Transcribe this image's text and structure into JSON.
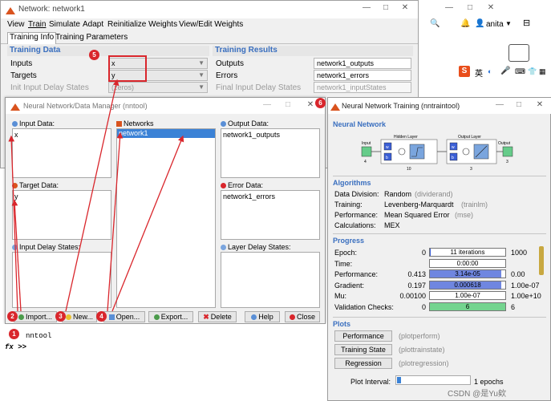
{
  "network_window": {
    "title": "Network: network1",
    "menu": [
      "View",
      "Train",
      "Simulate",
      "Adapt",
      "Reinitialize Weights",
      "View/Edit Weights"
    ],
    "tabs": [
      "Training Info",
      "Training Parameters"
    ],
    "training_data": {
      "header": "Training Data",
      "rows": [
        {
          "label": "Inputs",
          "value": "x"
        },
        {
          "label": "Targets",
          "value": "y"
        },
        {
          "label": "Init Input Delay States",
          "value": "(zeros)"
        }
      ]
    },
    "training_results": {
      "header": "Training Results",
      "rows": [
        {
          "label": "Outputs",
          "value": "network1_outputs"
        },
        {
          "label": "Errors",
          "value": "network1_errors"
        },
        {
          "label": "Final Input Delay States",
          "value": "network1_inputStates"
        }
      ]
    }
  },
  "tray": {
    "user": "anita",
    "ime": "英"
  },
  "data_manager": {
    "title": "Neural Network/Data Manager (nntool)",
    "input_data": {
      "label": "Input Data:",
      "items": [
        "x"
      ]
    },
    "networks": {
      "label": "Networks",
      "items": [
        "network1"
      ]
    },
    "output_data": {
      "label": "Output Data:",
      "items": [
        "network1_outputs"
      ]
    },
    "target_data": {
      "label": "Target Data:",
      "items": [
        "y"
      ]
    },
    "error_data": {
      "label": "Error Data:",
      "items": [
        "network1_errors"
      ]
    },
    "input_delay": {
      "label": "Input Delay States:"
    },
    "layer_delay": {
      "label": "Layer Delay States:"
    },
    "buttons": {
      "import": "Import...",
      "new": "New...",
      "open": "Open...",
      "export": "Export...",
      "delete": "Delete",
      "help": "Help",
      "close": "Close"
    }
  },
  "training_window": {
    "title": "Neural Network Training (nntraintool)",
    "network_header": "Neural Network",
    "diagram": {
      "input": "Input",
      "input_size": "4",
      "hidden": "Hidden Layer",
      "hidden_size": "10",
      "output_layer": "Output Layer",
      "output_layer_size": "3",
      "output": "Output",
      "output_size": "3",
      "w": "w",
      "b": "b"
    },
    "algorithms_header": "Algorithms",
    "algorithms": [
      {
        "label": "Data Division:",
        "value": "Random",
        "detail": "(dividerand)"
      },
      {
        "label": "Training:",
        "value": "Levenberg-Marquardt",
        "detail": "(trainlm)"
      },
      {
        "label": "Performance:",
        "value": "Mean Squared Error",
        "detail": "(mse)"
      },
      {
        "label": "Calculations:",
        "value": "MEX",
        "detail": ""
      }
    ],
    "progress_header": "Progress",
    "progress": [
      {
        "label": "Epoch:",
        "start": "0",
        "current": "11 iterations",
        "end": "1000",
        "fill": 0.011,
        "color": "#3b5fd6"
      },
      {
        "label": "Time:",
        "start": "",
        "current": "0:00:00",
        "end": "",
        "fill": 0,
        "color": "#3b5fd6"
      },
      {
        "label": "Performance:",
        "start": "0.413",
        "current": "3.14e-05",
        "end": "0.00",
        "fill": 0.95,
        "color": "#6f86e0"
      },
      {
        "label": "Gradient:",
        "start": "0.197",
        "current": "0.000618",
        "end": "1.00e-07",
        "fill": 0.95,
        "color": "#6f86e0"
      },
      {
        "label": "Mu:",
        "start": "0.00100",
        "current": "1.00e-07",
        "end": "1.00e+10",
        "fill": 0,
        "color": "#6f86e0"
      },
      {
        "label": "Validation Checks:",
        "start": "0",
        "current": "6",
        "end": "6",
        "fill": 1.0,
        "color": "#74d48f"
      }
    ],
    "plots_header": "Plots",
    "plots": [
      {
        "button": "Performance",
        "fn": "(plotperform)"
      },
      {
        "button": "Training State",
        "fn": "(plottrainstate)"
      },
      {
        "button": "Regression",
        "fn": "(plotregression)"
      }
    ],
    "plot_interval_label": "Plot Interval:",
    "plot_interval_value": "1 epochs"
  },
  "command_window": {
    "line1": "nntool",
    "prompt": "fx >>"
  },
  "annotations": [
    "1",
    "2",
    "3",
    "4",
    "5",
    "6"
  ],
  "watermark": "CSDN @是Yu欸"
}
